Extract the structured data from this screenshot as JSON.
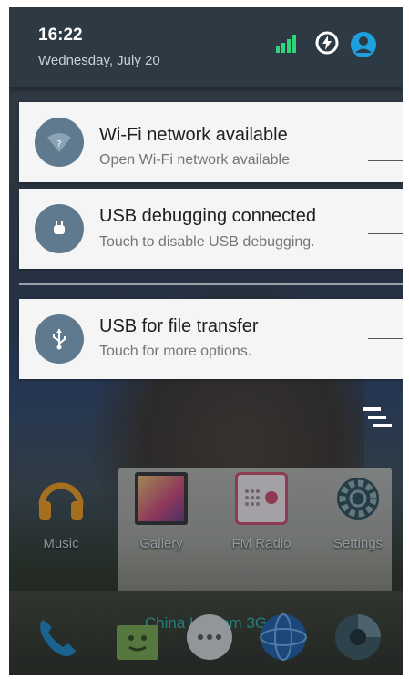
{
  "status": {
    "time": "16:22",
    "date": "Wednesday, July 20"
  },
  "notifications": [
    {
      "title": "Wi-Fi network available",
      "subtitle": "Open Wi-Fi network available",
      "icon": "wifi-question-icon"
    },
    {
      "title": "USB debugging connected",
      "subtitle": "Touch to disable USB debugging.",
      "icon": "android-debug-icon"
    },
    {
      "title": "USB for file transfer",
      "subtitle": "Touch for more options.",
      "icon": "usb-icon"
    }
  ],
  "apps": [
    {
      "label": "Music",
      "icon": "headphones-icon"
    },
    {
      "label": "Gallery",
      "icon": "gallery-icon"
    },
    {
      "label": "FM Radio",
      "icon": "radio-icon"
    },
    {
      "label": "Settings",
      "icon": "gear-icon"
    }
  ],
  "carrier": "China Unicom 3G",
  "dock": [
    {
      "icon": "phone-icon"
    },
    {
      "icon": "android-store-icon"
    },
    {
      "icon": "app-drawer-icon"
    },
    {
      "icon": "browser-globe-icon"
    },
    {
      "icon": "camera-lens-icon"
    }
  ],
  "colors": {
    "accent": "#2cc8c0",
    "signal": "#2fd37a",
    "notification_icon_bg": "#5f7a8e",
    "header_bg": "#2d3943"
  }
}
